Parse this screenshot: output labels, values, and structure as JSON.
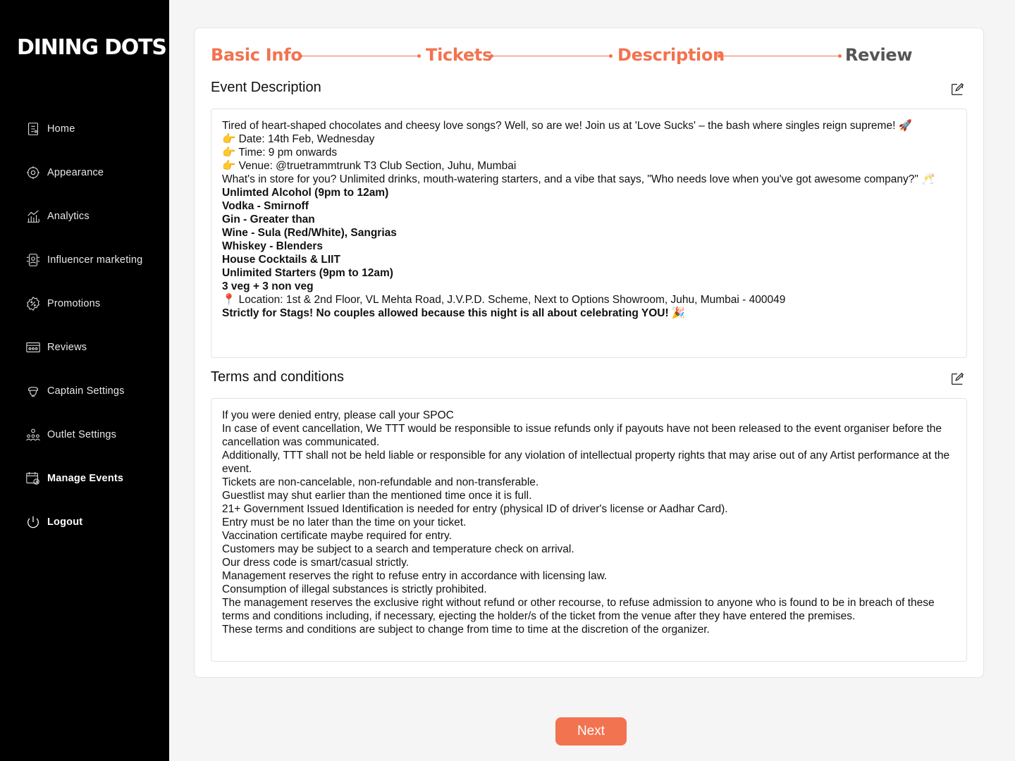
{
  "brand": {
    "logo_text": "DINING DOTS"
  },
  "sidebar": {
    "items": [
      {
        "label": "Home",
        "icon": "home-icon",
        "bold": false
      },
      {
        "label": "Appearance",
        "icon": "appearance-icon",
        "bold": false
      },
      {
        "label": "Analytics",
        "icon": "analytics-icon",
        "bold": false
      },
      {
        "label": "Influencer marketing",
        "icon": "influencer-icon",
        "bold": false
      },
      {
        "label": "Promotions",
        "icon": "promotions-icon",
        "bold": false
      },
      {
        "label": "Reviews",
        "icon": "reviews-icon",
        "bold": false
      },
      {
        "label": "Captain Settings",
        "icon": "captain-icon",
        "bold": false
      },
      {
        "label": "Outlet Settings",
        "icon": "outlet-icon",
        "bold": false
      },
      {
        "label": "Manage Events",
        "icon": "events-icon",
        "bold": true
      },
      {
        "label": "Logout",
        "icon": "power-icon",
        "bold": true
      }
    ]
  },
  "stepper": {
    "steps": [
      "Basic Info",
      "Tickets",
      "Description",
      "Review"
    ],
    "active_color": "#f2734f",
    "inactive_color": "#555555"
  },
  "description": {
    "title": "Event Description",
    "lines": [
      {
        "text": "Tired of heart-shaped chocolates and cheesy love songs? Well, so are we! Join us at 'Love Sucks' – the bash where singles reign supreme! 🚀",
        "bold": false
      },
      {
        "text": "👉 Date: 14th Feb, Wednesday",
        "bold": false
      },
      {
        "text": "👉 Time: 9 pm onwards",
        "bold": false
      },
      {
        "text": "👉 Venue: @truetrammtrunk T3 Club Section, Juhu, Mumbai",
        "bold": false
      },
      {
        "text": "What's in store for you? Unlimited drinks, mouth-watering starters, and a vibe that says, \"Who needs love when you've got awesome company?\" 🥂",
        "bold": false
      },
      {
        "text": "Unlimted Alcohol (9pm to 12am)",
        "bold": true
      },
      {
        "text": "Vodka - Smirnoff",
        "bold": true
      },
      {
        "text": "Gin - Greater than",
        "bold": true
      },
      {
        "text": "Wine - Sula (Red/White), Sangrias",
        "bold": true
      },
      {
        "text": "Whiskey - Blenders",
        "bold": true
      },
      {
        "text": "House Cocktails & LIIT",
        "bold": true
      },
      {
        "text": "Unlimited Starters (9pm to 12am)",
        "bold": true
      },
      {
        "text": "3 veg + 3 non veg",
        "bold": true
      },
      {
        "text": "📍 Location: 1st & 2nd Floor, VL Mehta Road, J.V.P.D. Scheme, Next to Options Showroom, Juhu, Mumbai - 400049",
        "bold": false
      },
      {
        "text": "Strictly for Stags! No couples allowed because this night is all about celebrating YOU! 🎉",
        "bold": true
      }
    ]
  },
  "terms": {
    "title": "Terms and conditions",
    "lines": [
      "If you were denied entry, please call your SPOC",
      "In case of event cancellation, We TTT would be responsible to issue refunds only if payouts have not been released to the event organiser before the cancellation was communicated.",
      "Additionally, TTT shall not be held liable or responsible for any violation of intellectual property rights that may arise out of any Artist performance at the event.",
      "Tickets are non-cancelable, non-refundable and non-transferable.",
      "Guestlist may shut earlier than the mentioned time once it is full.",
      "21+ Government Issued Identification is needed for entry (physical ID of driver's license or Aadhar Card).",
      "Entry must be no later than the time on your ticket.",
      "Vaccination certificate maybe required for entry.",
      "Customers may be subject to a search and temperature check on arrival.",
      "Our dress code is smart/casual strictly.",
      "Management reserves the right to refuse entry in accordance with licensing law.",
      "Consumption of illegal substances is strictly prohibited.",
      "The management reserves the exclusive right without refund or other recourse, to refuse admission to anyone who is found to be in breach of these terms and conditions including, if necessary, ejecting the holder/s of the ticket from the venue after they have entered the premises.",
      "These terms and conditions are subject to change from time to time at the discretion of the organizer."
    ]
  },
  "actions": {
    "next_label": "Next"
  }
}
